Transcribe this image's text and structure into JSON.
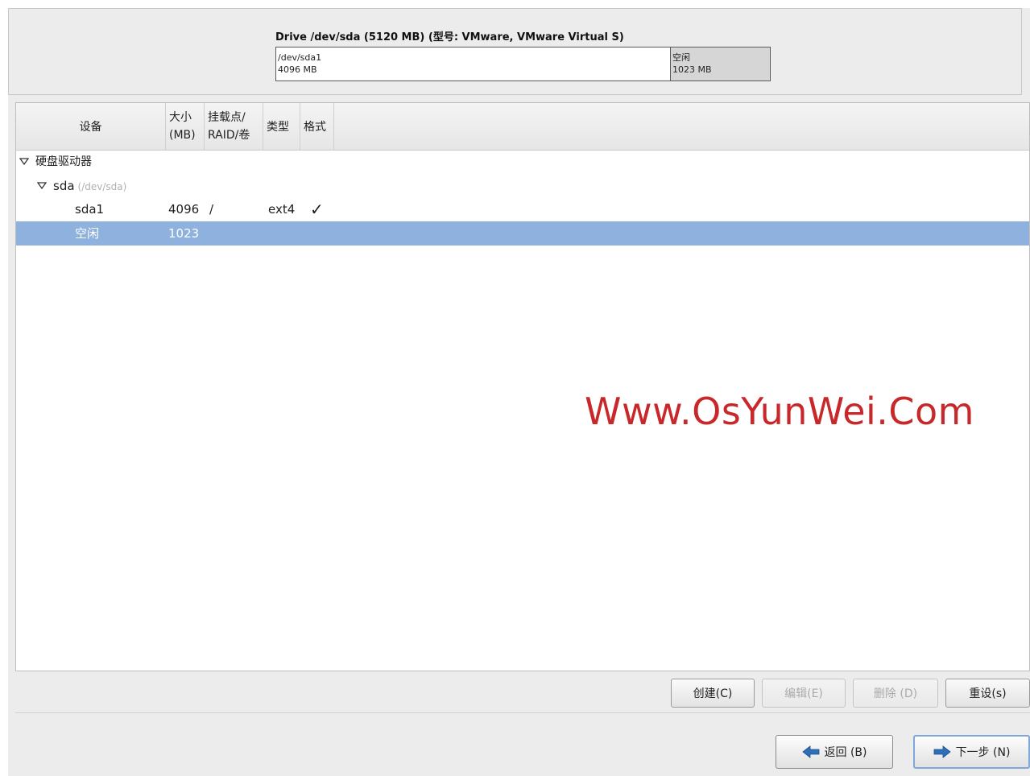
{
  "drive": {
    "title": "Drive /dev/sda (5120 MB) (型号: VMware, VMware Virtual S)",
    "segments": [
      {
        "name": "/dev/sda1",
        "size": "4096 MB"
      },
      {
        "name": "空闲",
        "size": "1023 MB"
      }
    ]
  },
  "table": {
    "headers": {
      "device": "设备",
      "size_line1": "大小",
      "size_line2": "(MB)",
      "mount_line1": "挂载点/",
      "mount_line2": "RAID/卷",
      "type": "类型",
      "format": "格式"
    },
    "rows": {
      "group": {
        "label": "硬盘驱动器"
      },
      "disk": {
        "label": "sda",
        "path": "(/dev/sda)"
      },
      "sda1": {
        "device": "sda1",
        "size": "4096",
        "mount": "/",
        "type": "ext4",
        "format": "✓"
      },
      "free": {
        "device": "空闲",
        "size": "1023"
      }
    }
  },
  "watermark": "Www.OsYunWei.Com",
  "actions": {
    "create": "创建(C)",
    "edit": "编辑(E)",
    "delete": "删除 (D)",
    "reset": "重设(s)"
  },
  "navigation": {
    "back": "返回 (B)",
    "next": "下一步 (N)"
  },
  "colors": {
    "selection": "#8eb1de",
    "watermark": "#c8282a",
    "nav_arrow": "#2f6fb8"
  }
}
